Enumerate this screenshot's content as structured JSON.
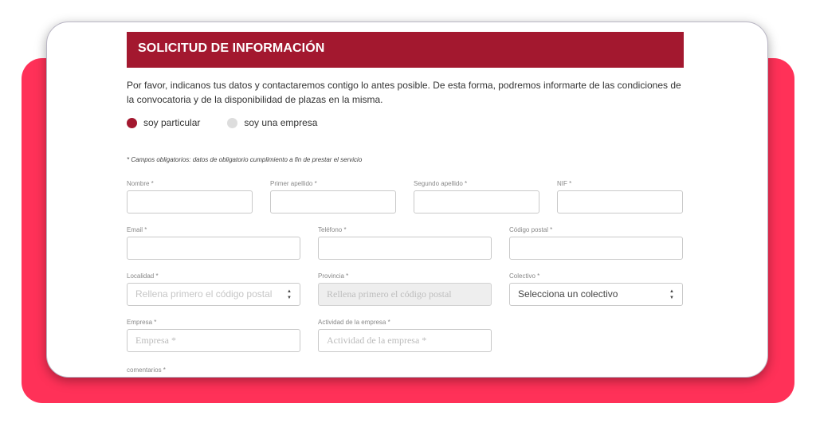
{
  "header": {
    "title": "SOLICITUD DE INFORMACIÓN"
  },
  "intro": "Por favor, indicanos tus datos y contactaremos contigo lo antes posible. De esta forma, podremos informarte de las condiciones de la convocatoria y de la disponibilidad de plazas en la misma.",
  "radios": {
    "particular": "soy particular",
    "empresa": "soy una empresa"
  },
  "note": "* Campos obligatorios: datos de obligatorio cumplimiento a fin de prestar el servicio",
  "fields": {
    "nombre": {
      "label": "Nombre *",
      "value": ""
    },
    "apellido1": {
      "label": "Primer apellido *",
      "value": ""
    },
    "apellido2": {
      "label": "Segundo apellido *",
      "value": ""
    },
    "nif": {
      "label": "NIF *",
      "value": ""
    },
    "email": {
      "label": "Email *",
      "value": ""
    },
    "telefono": {
      "label": "Teléfono *",
      "value": ""
    },
    "cp": {
      "label": "Código postal *",
      "value": ""
    },
    "localidad": {
      "label": "Localidad *",
      "value": "Rellena primero el código postal"
    },
    "provincia": {
      "label": "Provincia *",
      "value": "Rellena primero el código postal"
    },
    "colectivo": {
      "label": "Colectivo *",
      "value": "Selecciona un colectivo"
    },
    "empresa": {
      "label": "Empresa *",
      "placeholder": "Empresa *"
    },
    "actividad": {
      "label": "Actividad de la empresa *",
      "placeholder": "Actividad de la empresa *"
    },
    "comentarios": {
      "label": "comentarios *"
    }
  },
  "colors": {
    "accent": "#a3182f",
    "frame": "#ff3158"
  },
  "icons": {
    "select_caret": "up-down-caret-icon"
  }
}
